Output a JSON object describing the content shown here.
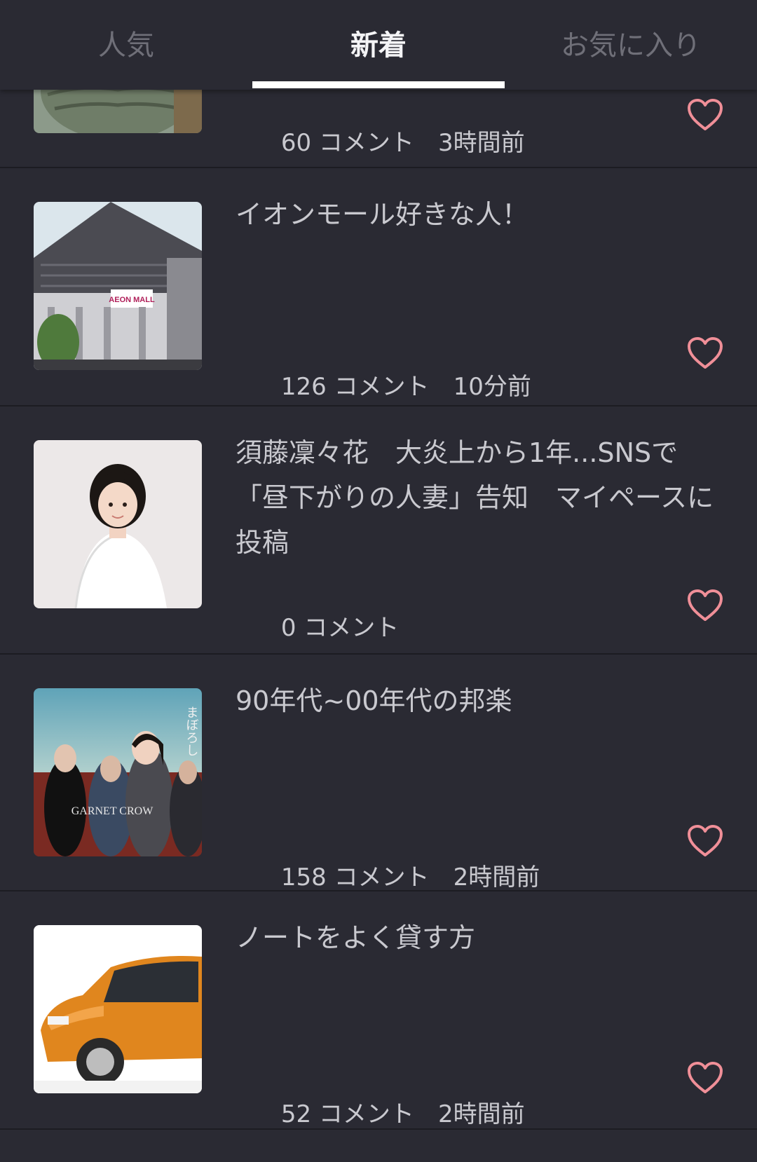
{
  "tabs": [
    {
      "label": "人気"
    },
    {
      "label": "新着"
    },
    {
      "label": "お気に入り"
    }
  ],
  "active_tab": "新着",
  "accent_color": "#f08f98",
  "items": [
    {
      "title": "",
      "comments": "60 コメント",
      "time": "3時間前",
      "thumb": "buddha-statue"
    },
    {
      "title": "イオンモール好きな人！",
      "comments": "126 コメント",
      "time": "10分前",
      "thumb": "aeon-mall-building",
      "logo_text": "AEON MALL"
    },
    {
      "title": "須藤凜々花　大炎上から1年...SNSで「昼下がりの人妻」告知　マイペースに投稿",
      "comments": "0 コメント",
      "time": "",
      "thumb": "woman-portrait"
    },
    {
      "title": "90年代~00年代の邦楽",
      "comments": "158 コメント",
      "time": "2時間前",
      "thumb": "garnet-crow-cover",
      "cover_text": "GARNET CROW",
      "cover_side_text": "まぼろし"
    },
    {
      "title": "ノートをよく貸す方",
      "comments": "52 コメント",
      "time": "2時間前",
      "thumb": "orange-car"
    }
  ]
}
